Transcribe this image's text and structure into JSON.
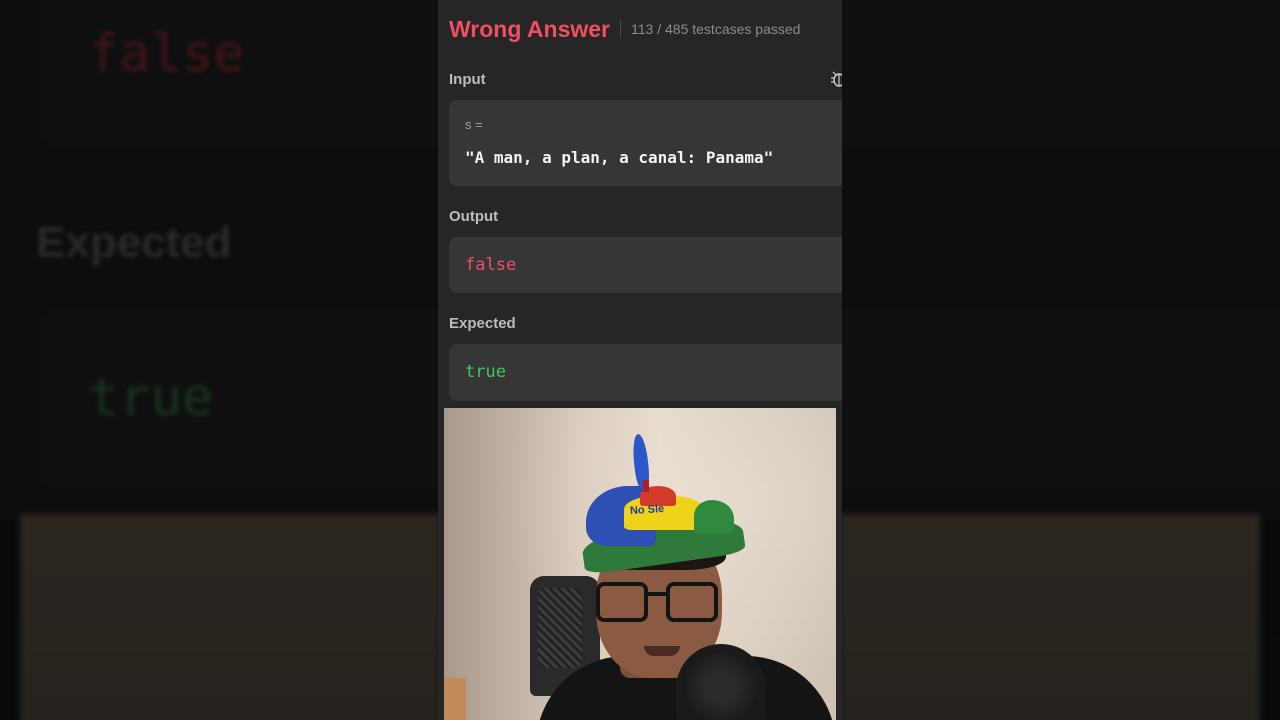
{
  "background": {
    "heading": "Expected",
    "output_value": "false",
    "expected_value": "true"
  },
  "result": {
    "status": "Wrong Answer",
    "testcases": "113 / 485 testcases passed"
  },
  "input": {
    "label": "Input",
    "var_name": "s =",
    "value": "\"A man, a plan, a canal: Panama\""
  },
  "output": {
    "label": "Output",
    "value": "false"
  },
  "expected": {
    "label": "Expected",
    "value": "true"
  },
  "webcam": {
    "cap_text": "No Sle"
  },
  "colors": {
    "error": "#ef4f5f",
    "success": "#3ec85a",
    "panel": "#262626",
    "card": "#363636"
  }
}
